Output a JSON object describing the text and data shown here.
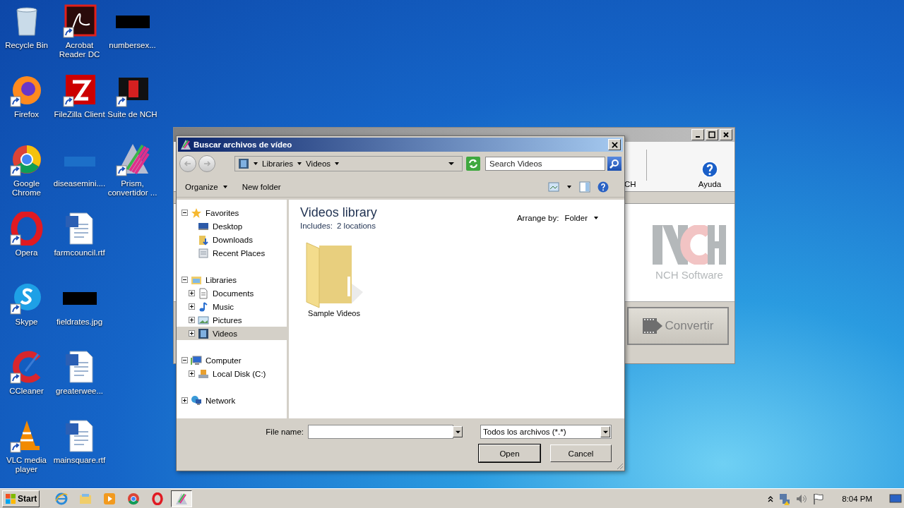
{
  "desktop_icons": [
    {
      "label": "Recycle Bin",
      "kind": "bin",
      "shortcut": false
    },
    {
      "label": "Firefox",
      "kind": "firefox",
      "shortcut": true
    },
    {
      "label": "Google Chrome",
      "kind": "chrome",
      "shortcut": true
    },
    {
      "label": "Opera",
      "kind": "opera",
      "shortcut": true
    },
    {
      "label": "Skype",
      "kind": "skype",
      "shortcut": true
    },
    {
      "label": "CCleaner",
      "kind": "ccleaner",
      "shortcut": true
    },
    {
      "label": "VLC media player",
      "kind": "vlc",
      "shortcut": true
    },
    {
      "label": "Acrobat Reader DC",
      "kind": "pdf",
      "shortcut": true
    },
    {
      "label": "FileZilla Client",
      "kind": "filezilla",
      "shortcut": true
    },
    {
      "label": "diseasemini....",
      "kind": "blank",
      "shortcut": false
    },
    {
      "label": "farmcouncil.rtf",
      "kind": "word",
      "shortcut": false
    },
    {
      "label": "fieldrates.jpg",
      "kind": "image",
      "shortcut": false
    },
    {
      "label": "greaterwee...",
      "kind": "word",
      "shortcut": false
    },
    {
      "label": "mainsquare.rtf",
      "kind": "word",
      "shortcut": false
    },
    {
      "label": "numbersex...",
      "kind": "image",
      "shortcut": false
    },
    {
      "label": "Suite de NCH",
      "kind": "nch",
      "shortcut": true
    },
    {
      "label": "Prism, convertidor ...",
      "kind": "prism",
      "shortcut": true
    }
  ],
  "background_window": {
    "toolbar_items": [
      {
        "label": "CH",
        "kind": "nch"
      },
      {
        "label": "Ayuda",
        "kind": "help"
      }
    ],
    "logo_text": "NCH Software",
    "convert_button": {
      "label": "Convertir",
      "disabled": true
    }
  },
  "dialog": {
    "title": "Buscar archivos de vídeo",
    "breadcrumb": [
      "Libraries",
      "Videos"
    ],
    "search": {
      "placeholder": "Search Videos"
    },
    "commands": [
      {
        "label": "Organize",
        "kind": "menu"
      },
      {
        "label": "New folder",
        "kind": "button"
      }
    ],
    "nav_tree": [
      {
        "label": "Favorites",
        "expanded": true,
        "selected": false,
        "children": [
          {
            "label": "Desktop",
            "selected": false
          },
          {
            "label": "Downloads",
            "selected": false
          },
          {
            "label": "Recent Places",
            "selected": false
          }
        ]
      },
      {
        "label": "Libraries",
        "expanded": true,
        "selected": false,
        "children": [
          {
            "label": "Documents",
            "expanded": false,
            "selected": false
          },
          {
            "label": "Music",
            "expanded": false,
            "selected": false
          },
          {
            "label": "Pictures",
            "expanded": false,
            "selected": false
          },
          {
            "label": "Videos",
            "expanded": false,
            "selected": true
          }
        ]
      },
      {
        "label": "Computer",
        "expanded": true,
        "selected": false,
        "children": [
          {
            "label": "Local Disk (C:)",
            "expanded": false,
            "selected": false
          }
        ]
      },
      {
        "label": "Network",
        "expanded": false,
        "selected": false
      }
    ],
    "library": {
      "title": "Videos library",
      "includes_label": "Includes:",
      "includes_link": "2 locations",
      "arrange_label": "Arrange by:",
      "arrange_value": "Folder"
    },
    "items": [
      {
        "label": "Sample Videos",
        "selected": false
      }
    ],
    "file_name": {
      "label": "File name:"
    },
    "file_type": "Todos los archivos (*.*)",
    "buttons": [
      {
        "label": "Open",
        "default": true
      },
      {
        "label": "Cancel",
        "default": false
      }
    ]
  },
  "taskbar": {
    "start": "Start",
    "pinned": [
      {
        "kind": "ie",
        "active": false
      },
      {
        "kind": "explorer",
        "active": false
      },
      {
        "kind": "media",
        "active": false
      },
      {
        "kind": "chrome",
        "active": false
      },
      {
        "kind": "opera",
        "active": false
      },
      {
        "kind": "prism",
        "active": true
      }
    ],
    "clock": "8:04 PM"
  }
}
